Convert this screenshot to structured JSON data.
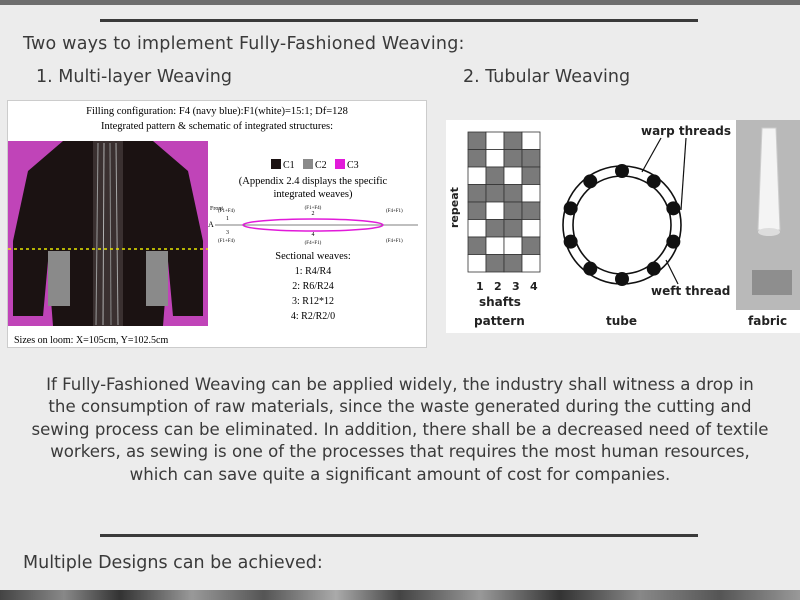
{
  "heading": "Two ways to implement Fully-Fashioned Weaving:",
  "method1": "1. Multi-layer Weaving",
  "method2": "2. Tubular Weaving",
  "left_figure": {
    "filling_config": "Filling configuration: F4 (navy blue):F1(white)=15:1; Df=128",
    "caption": "Integrated pattern & schematic of integrated structures:",
    "legend": [
      "C1",
      "C2",
      "C3"
    ],
    "appendix_note": "(Appendix 2.4 displays the specific integrated weaves)",
    "sectional_title": "Sectional weaves:",
    "weaves": [
      "1: R4/R4",
      "2: R6/R24",
      "3: R12*12",
      "4: R2/R2/0"
    ],
    "sizes": "Sizes on loom: X=105cm, Y=102.5cm",
    "diagram_labels": {
      "front": "Front",
      "a": "A",
      "n1": "1",
      "n2": "2",
      "n3": "3",
      "n4": "4",
      "f1f4": "(F1+F4)",
      "f4f1": "(F4+F1)"
    },
    "colors": {
      "c1": "#1b1212",
      "c2": "#8a8a8a",
      "c3": "#e11ad9",
      "bg_magenta": "#c044b8"
    }
  },
  "right_figure": {
    "repeat_label": "repeat",
    "shaft_numbers": [
      "1",
      "2",
      "3",
      "4"
    ],
    "shafts_label": "shafts",
    "pattern_label": "pattern",
    "warp_label": "warp threads",
    "weft_label": "weft thread",
    "tube_label": "tube",
    "fabric_label": "fabric"
  },
  "body": "If Fully-Fashioned Weaving can be applied widely, the industry shall witness a drop in the consumption of raw materials, since the waste generated during the cutting and sewing process can be eliminated. In addition, there shall be a decreased need of textile workers, as sewing is one of the processes that requires the most human resources, which can save quite a significant amount of cost for companies.",
  "closing": "Multiple Designs can be achieved:"
}
